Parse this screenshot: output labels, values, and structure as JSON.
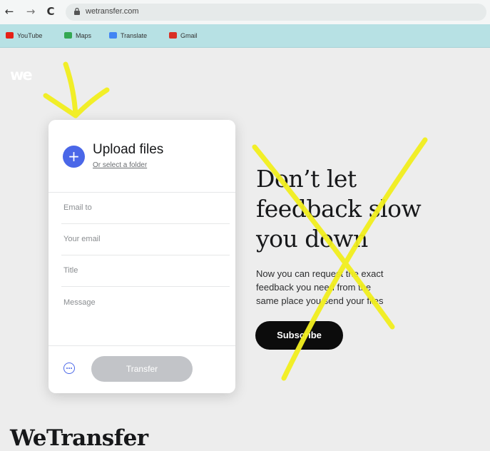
{
  "browser": {
    "url": "wetransfer.com",
    "bookmarks": [
      {
        "label": "YouTube",
        "color": "#e62117"
      },
      {
        "label": "Maps",
        "color": "#34a853"
      },
      {
        "label": "Translate",
        "color": "#4285f4"
      },
      {
        "label": "Gmail",
        "color": "#d93025"
      }
    ]
  },
  "page": {
    "logo": "we",
    "brand": "WeTransfer"
  },
  "uploader": {
    "title": "Upload files",
    "select_folder": "Or select a folder",
    "fields": {
      "email_to": "Email to",
      "your_email": "Your email",
      "title": "Title",
      "message": "Message"
    },
    "transfer_label": "Transfer"
  },
  "promo": {
    "headline_lines": [
      "Don’t let",
      "feedback slow",
      "you down"
    ],
    "body_lines": [
      "Now you can request the exact",
      "feedback you need from the",
      "same place you send your files"
    ],
    "cta": "Subscribe"
  },
  "colors": {
    "accent": "#4a67e8",
    "annotation": "#f2ef1e",
    "bookmarks_bar": "#b7e1e4"
  }
}
